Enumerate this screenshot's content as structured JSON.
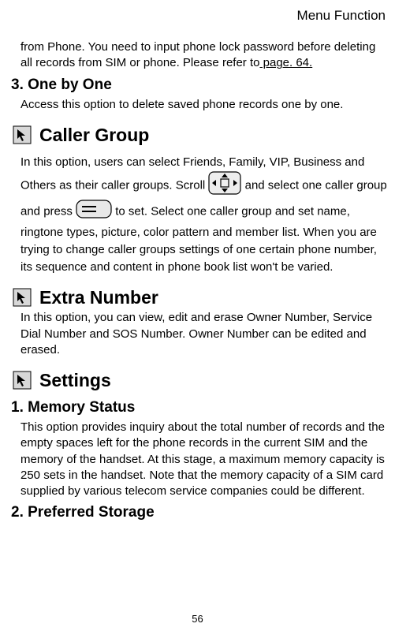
{
  "header": "Menu Function",
  "intro": {
    "part1": "from Phone. You need to input phone lock password before deleting all records from SIM or phone. Please refer to",
    "link": " page. 64."
  },
  "sections": {
    "one_by_one": {
      "title": "3. One by One",
      "body": "Access this option to delete saved phone records one by one."
    },
    "caller_group": {
      "title": "Caller Group",
      "p1": "In this option, users can select Friends, Family, VIP, Business and Others as their caller groups. Scroll ",
      "p2": " and select one caller group and press ",
      "p3": " to set. Select one caller group and set name, ringtone types, picture, color pattern and member list. When you are trying to change caller groups settings of one certain phone number, its sequence and content in phone book list won't be varied."
    },
    "extra_number": {
      "title": "Extra Number",
      "body": "In this option, you can view, edit and erase Owner Number, Service Dial Number and SOS Number. Owner Number can be edited and erased."
    },
    "settings": {
      "title": "Settings"
    },
    "memory_status": {
      "title": "1. Memory Status",
      "body": "This option provides inquiry about the total number of records and the empty spaces left for the phone records in the current SIM and the memory of the handset. At this stage, a maximum memory capacity is 250 sets in the handset. Note that the memory capacity of a SIM card supplied by various telecom service companies could be different."
    },
    "preferred_storage": {
      "title": "2. Preferred Storage"
    }
  },
  "page_number": "56"
}
